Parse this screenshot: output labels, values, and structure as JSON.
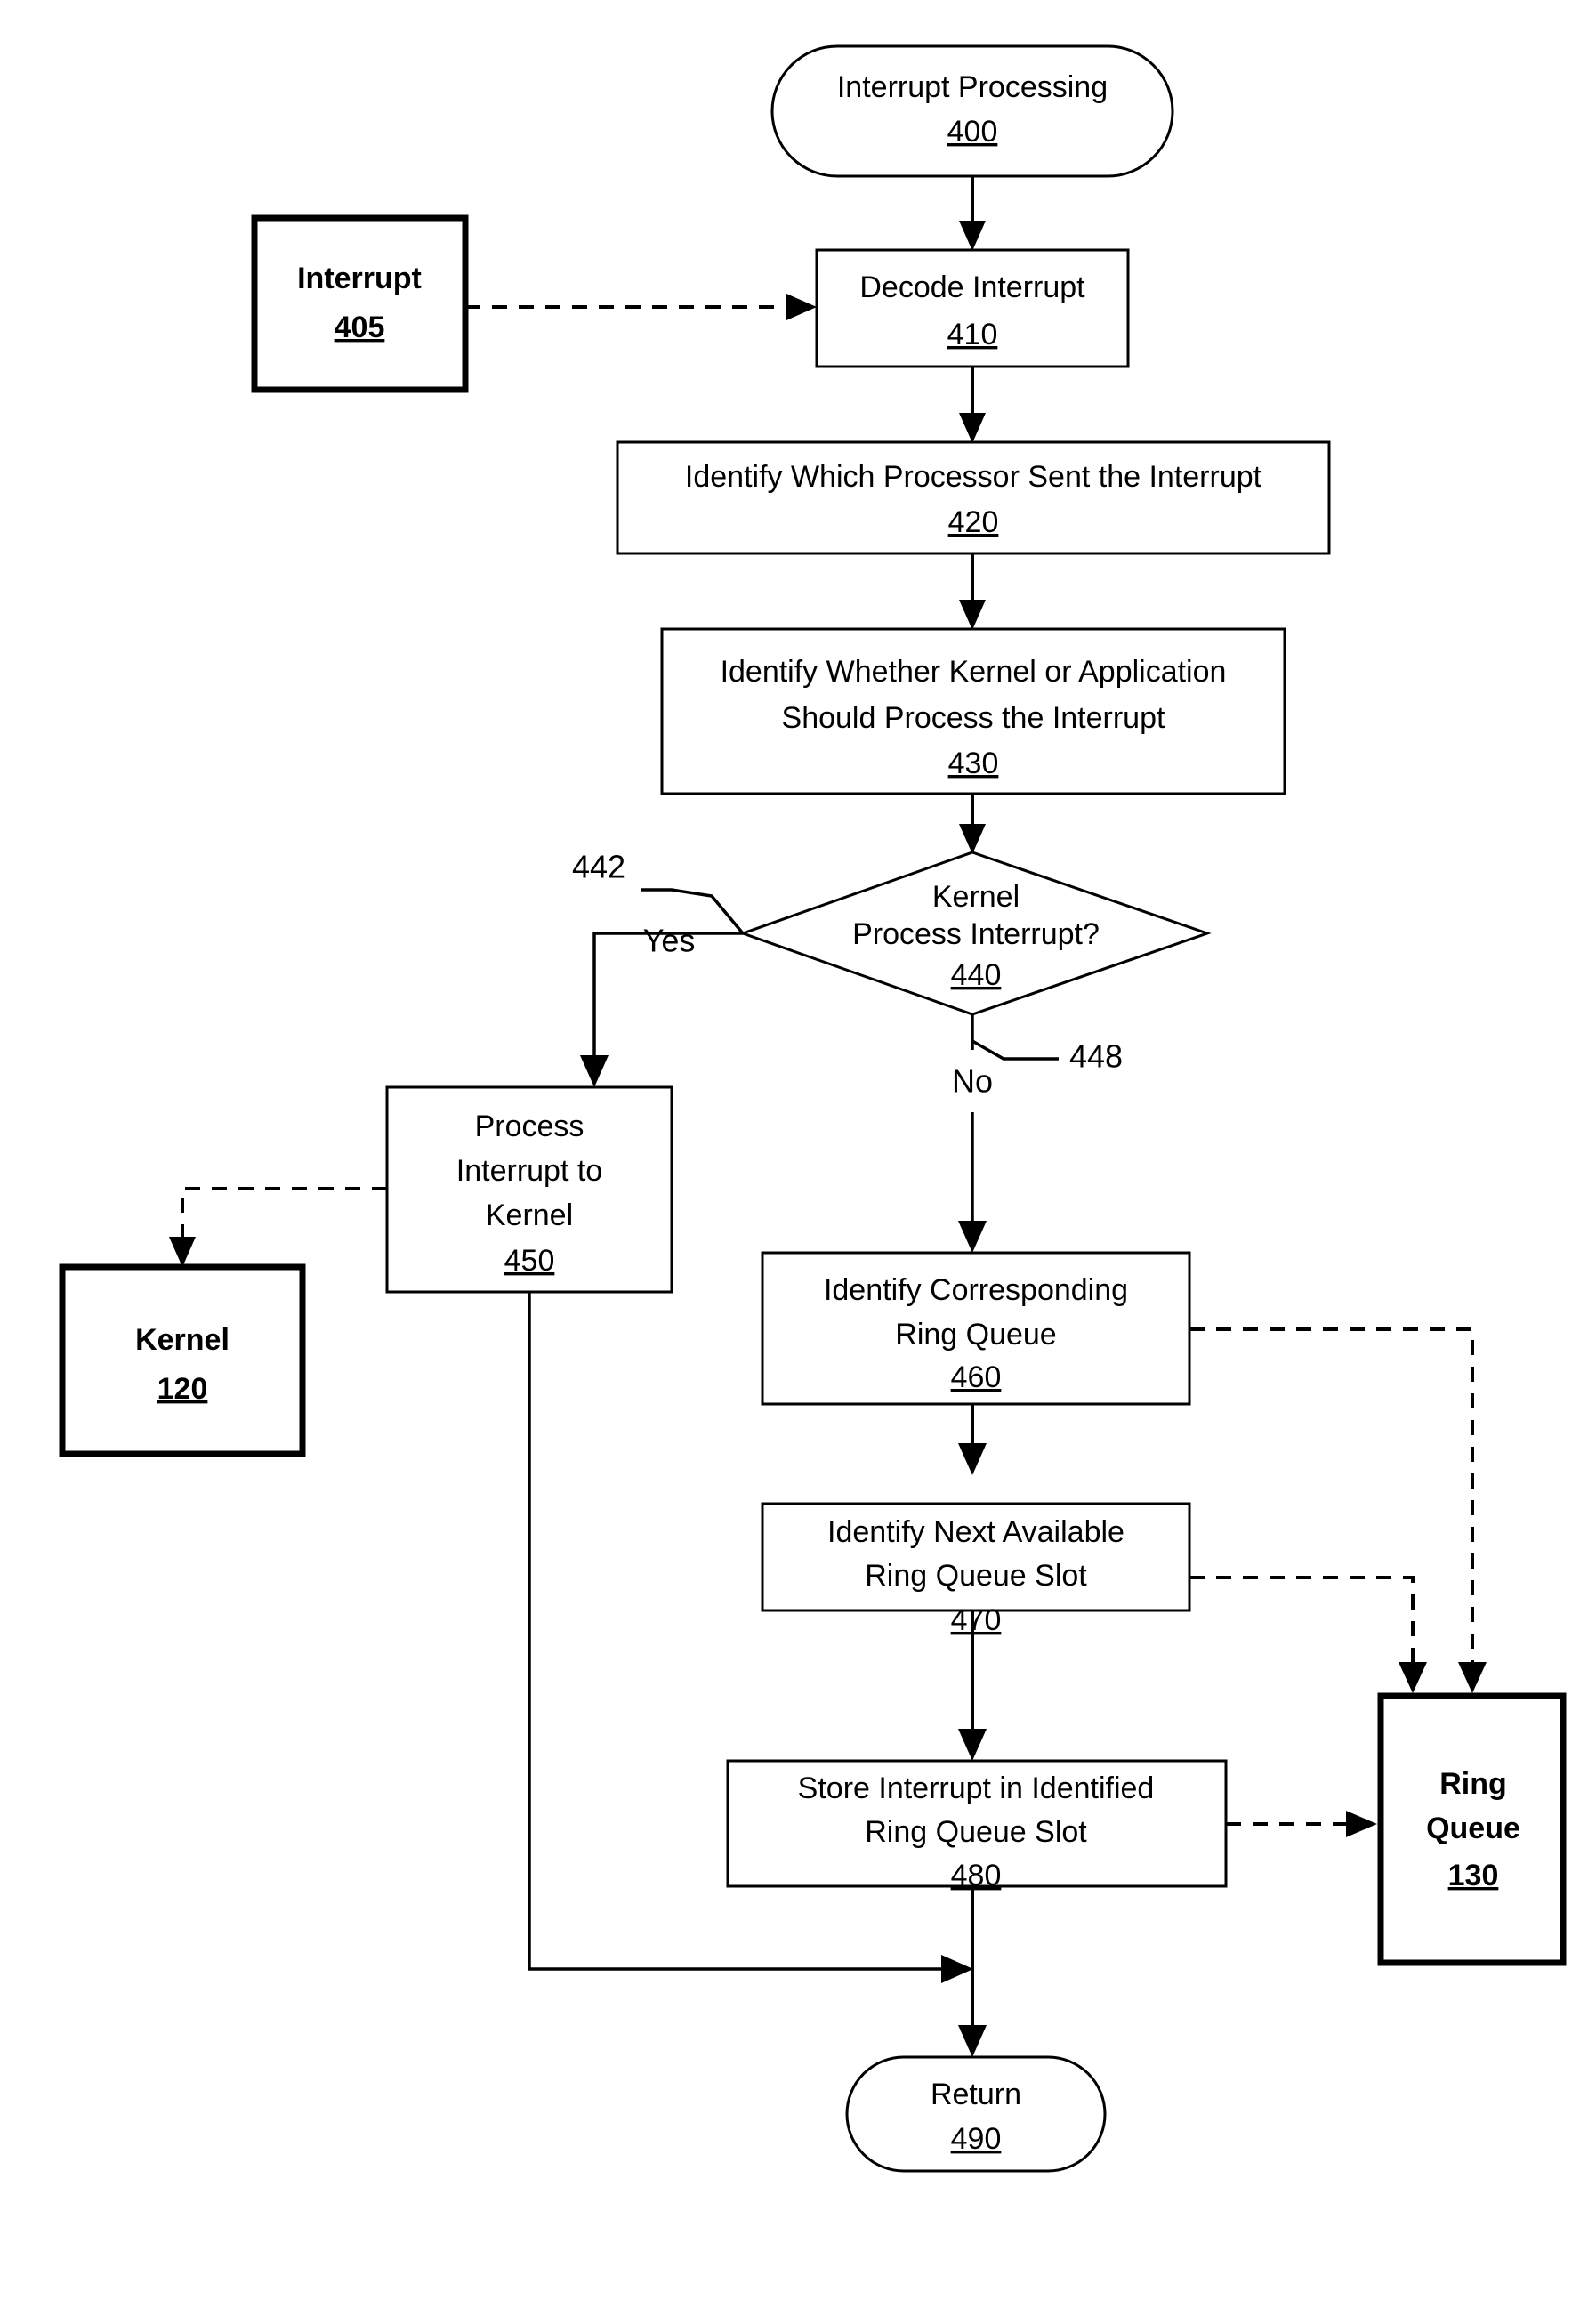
{
  "figure": {
    "kind": "flowchart",
    "title": "Interrupt Processing",
    "orientation": "top-to-bottom"
  },
  "nodes": {
    "start": {
      "label": "Interrupt Processing",
      "ref": "400",
      "shape": "terminator"
    },
    "interrupt_source": {
      "label": "Interrupt",
      "ref": "405",
      "shape": "bold-rect"
    },
    "decode": {
      "label": "Decode Interrupt",
      "ref": "410",
      "shape": "rect"
    },
    "identify_processor": {
      "label": "Identify Which Processor Sent the Interrupt",
      "ref": "420",
      "shape": "rect"
    },
    "identify_handler": {
      "label_line1": "Identify Whether Kernel or Application",
      "label_line2": "Should Process the Interrupt",
      "ref": "430",
      "shape": "rect"
    },
    "decision": {
      "label_line1": "Kernel",
      "label_line2": "Process Interrupt?",
      "ref": "440",
      "shape": "diamond"
    },
    "process_to_kernel": {
      "label_line1": "Process",
      "label_line2": "Interrupt to",
      "label_line3": "Kernel",
      "ref": "450",
      "shape": "rect"
    },
    "kernel": {
      "label": "Kernel",
      "ref": "120",
      "shape": "bold-rect"
    },
    "identify_ring_queue": {
      "label_line1": "Identify Corresponding",
      "label_line2": "Ring Queue",
      "ref": "460",
      "shape": "rect"
    },
    "identify_slot": {
      "label_line1": "Identify Next Available",
      "label_line2": "Ring Queue Slot",
      "ref": "470",
      "shape": "rect"
    },
    "store_interrupt": {
      "label_line1": "Store Interrupt in Identified",
      "label_line2": "Ring Queue Slot",
      "ref": "480",
      "shape": "rect"
    },
    "ring_queue": {
      "label_line1": "Ring",
      "label_line2": "Queue",
      "ref": "130",
      "shape": "bold-rect"
    },
    "end": {
      "label": "Return",
      "ref": "490",
      "shape": "terminator"
    }
  },
  "branches": {
    "yes_label": "Yes",
    "no_label": "No",
    "yes_ref": "442",
    "no_ref": "448"
  },
  "colors": {
    "stroke": "#000000",
    "fill": "#ffffff"
  }
}
